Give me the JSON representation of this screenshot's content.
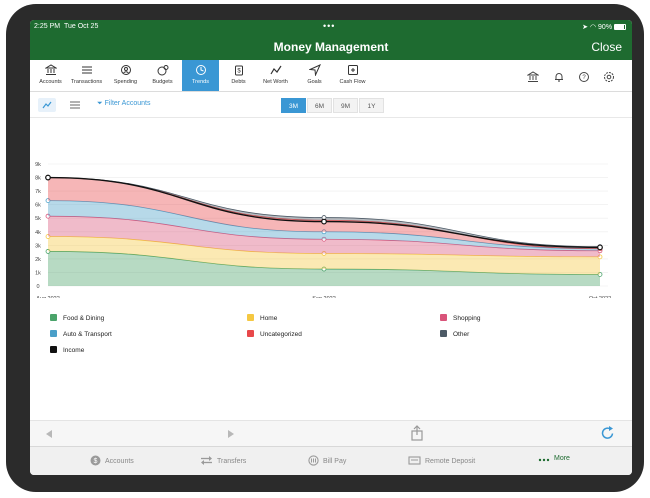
{
  "status": {
    "time": "2:25 PM",
    "date": "Tue Oct 25",
    "battery": "90%"
  },
  "header": {
    "title": "Money Management",
    "close_label": "Close"
  },
  "nav": {
    "items": [
      {
        "label": "Accounts",
        "icon": "bank-icon"
      },
      {
        "label": "Transactions",
        "icon": "list-icon"
      },
      {
        "label": "Spending",
        "icon": "spending-icon"
      },
      {
        "label": "Budgets",
        "icon": "budget-icon"
      },
      {
        "label": "Trends",
        "icon": "trends-icon"
      },
      {
        "label": "Debts",
        "icon": "debts-icon"
      },
      {
        "label": "Net Worth",
        "icon": "net-worth-icon"
      },
      {
        "label": "Goals",
        "icon": "goals-icon"
      },
      {
        "label": "Cash Flow",
        "icon": "cash-flow-icon"
      }
    ],
    "active_index": 4,
    "right_icons": [
      "bank-icon",
      "bell-icon",
      "help-icon",
      "settings-icon"
    ]
  },
  "toolbar": {
    "filter_label": "Filter Accounts",
    "ranges": [
      "3M",
      "6M",
      "9M",
      "1Y"
    ],
    "selected_range": "3M"
  },
  "chart_data": {
    "type": "area",
    "x": [
      "Aug 2022",
      "Sep 2022",
      "Oct 2022"
    ],
    "y_ticks": [
      "0",
      "1k",
      "2k",
      "3k",
      "4k",
      "5k",
      "6k",
      "7k",
      "8k",
      "9k"
    ],
    "ylim": [
      0,
      9000
    ],
    "stacked": true,
    "series": [
      {
        "name": "Food & Dining",
        "color": "#4aa36a",
        "values": [
          2550,
          1250,
          850
        ]
      },
      {
        "name": "Home",
        "color": "#f5c842",
        "values": [
          1100,
          1150,
          1300
        ]
      },
      {
        "name": "Shopping",
        "color": "#d9547a",
        "values": [
          1500,
          1050,
          450
        ]
      },
      {
        "name": "Auto & Transport",
        "color": "#4a9fc8",
        "values": [
          1150,
          550,
          150
        ]
      },
      {
        "name": "Uncategorized",
        "color": "#e8484a",
        "values": [
          1700,
          850,
          0
        ]
      },
      {
        "name": "Other",
        "color": "#4d5a66",
        "values": [
          0,
          200,
          150
        ]
      }
    ],
    "line_series": [
      {
        "name": "Income",
        "color": "#111111",
        "values": [
          8000,
          4750,
          2850
        ]
      }
    ],
    "legend_rows": [
      [
        "Food & Dining",
        "Home",
        "Shopping"
      ],
      [
        "Auto & Transport",
        "Uncategorized",
        "Other"
      ],
      [
        "Income"
      ]
    ]
  },
  "tabbar": {
    "items": [
      {
        "label": "Accounts",
        "icon": "dollar-icon"
      },
      {
        "label": "Transfers",
        "icon": "transfer-icon"
      },
      {
        "label": "Bill Pay",
        "icon": "bill-pay-icon"
      },
      {
        "label": "Remote Deposit",
        "icon": "check-deposit-icon"
      },
      {
        "label": "More",
        "icon": "more-icon"
      }
    ],
    "active_index": 4
  },
  "colors": {
    "brand": "#1e6b30",
    "accent": "#3a97d4"
  }
}
